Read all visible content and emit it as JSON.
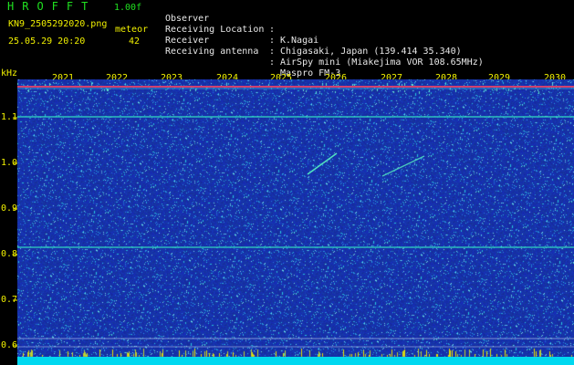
{
  "header": {
    "title": "HROFFT",
    "version": "1.00f",
    "filename": "KN9_2505292020.png",
    "timestamp": "25.05.29 20:20",
    "meteor_label": "meteor",
    "meteor_count": "42"
  },
  "info": [
    {
      "label": "Observer",
      "sep": ":",
      "value": "K.Nagai"
    },
    {
      "label": "Receiving Location",
      "sep": ":",
      "value": "Chigasaki, Japan (139.414 35.340)"
    },
    {
      "label": "Receiver",
      "sep": ":",
      "value": "AirSpy mini (Miakejima VOR 108.65MHz)"
    },
    {
      "label": "Receiving antenna",
      "sep": ":",
      "value": "Maspro FM-3"
    }
  ],
  "axis": {
    "y_unit": "kHz",
    "y_ticks": [
      "1.1",
      "1.0",
      "0.9",
      "0.8",
      "0.7",
      "0.6"
    ],
    "x_ticks": [
      "2021",
      "2022",
      "2023",
      "2024",
      "2025",
      "2026",
      "2027",
      "2028",
      "2029",
      "2030"
    ]
  },
  "colors": {
    "background": "#000000",
    "waterfall": "#1c2fa8",
    "text_yellow": "#f0f000",
    "text_green": "#20e020",
    "text_white": "#e8e8e8",
    "top_line": "#d04070",
    "carrier_line": "#30d0c0",
    "base_band": "#00d8f0"
  }
}
